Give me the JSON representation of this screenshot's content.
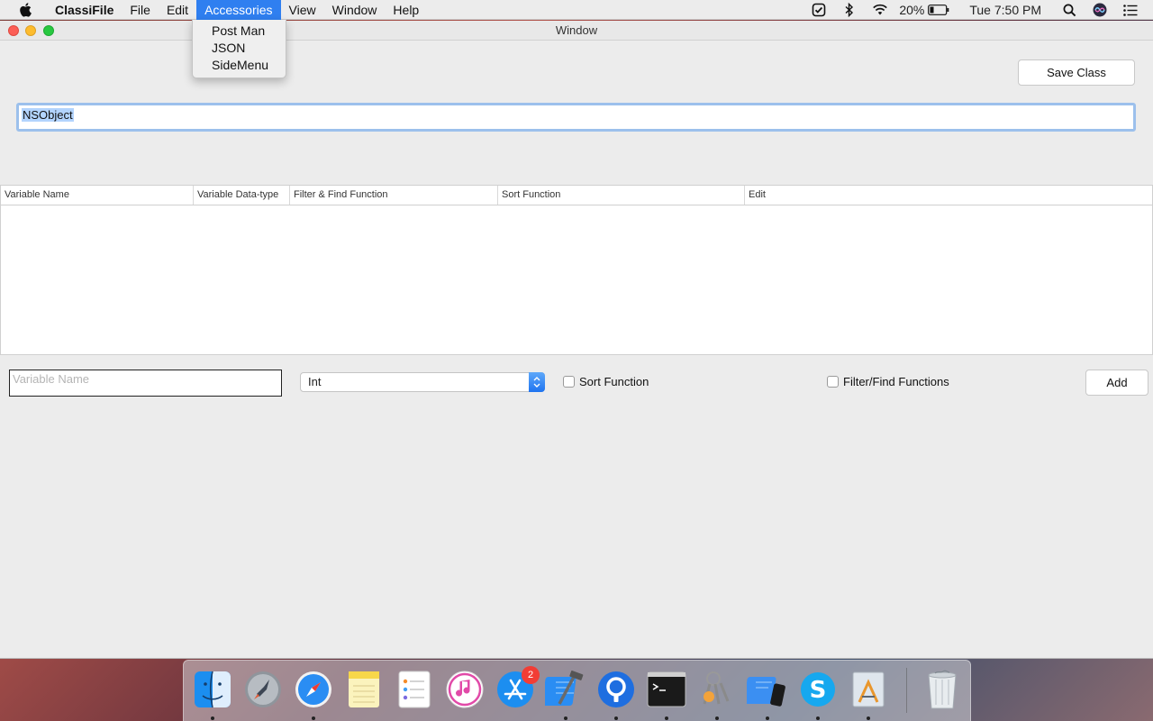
{
  "menubar": {
    "app_name": "ClassiFile",
    "menus": [
      "File",
      "Edit",
      "Accessories",
      "View",
      "Window",
      "Help"
    ],
    "active_menu": "Accessories",
    "battery": "20%",
    "clock": "Tue 7:50 PM",
    "status_icons": [
      "todo-check-icon",
      "bluetooth-icon",
      "wifi-icon",
      "battery-icon",
      "search-icon",
      "siri-icon",
      "notification-center-icon"
    ]
  },
  "accessories_menu": {
    "items": [
      "Post Man",
      "JSON",
      "SideMenu"
    ]
  },
  "window": {
    "title": "Window",
    "save_button": "Save Class",
    "class_name_value": "NSObject",
    "table": {
      "columns": [
        "Variable Name",
        "Variable Data-type",
        "Filter & Find Function",
        "Sort Function",
        "Edit"
      ],
      "rows": []
    },
    "variable_name_placeholder": "Variable Name",
    "type_select_value": "Int",
    "sort_function_label": "Sort Function",
    "filter_find_label": "Filter/Find Functions",
    "add_button": "Add"
  },
  "dock": {
    "apps": [
      "finder",
      "launchpad",
      "safari",
      "notes",
      "reminders",
      "itunes",
      "app-store",
      "xcode",
      "sourcetree",
      "terminal",
      "keychain-access",
      "simulator",
      "skype",
      "instruments",
      "trash"
    ],
    "app_store_badge": "2"
  }
}
